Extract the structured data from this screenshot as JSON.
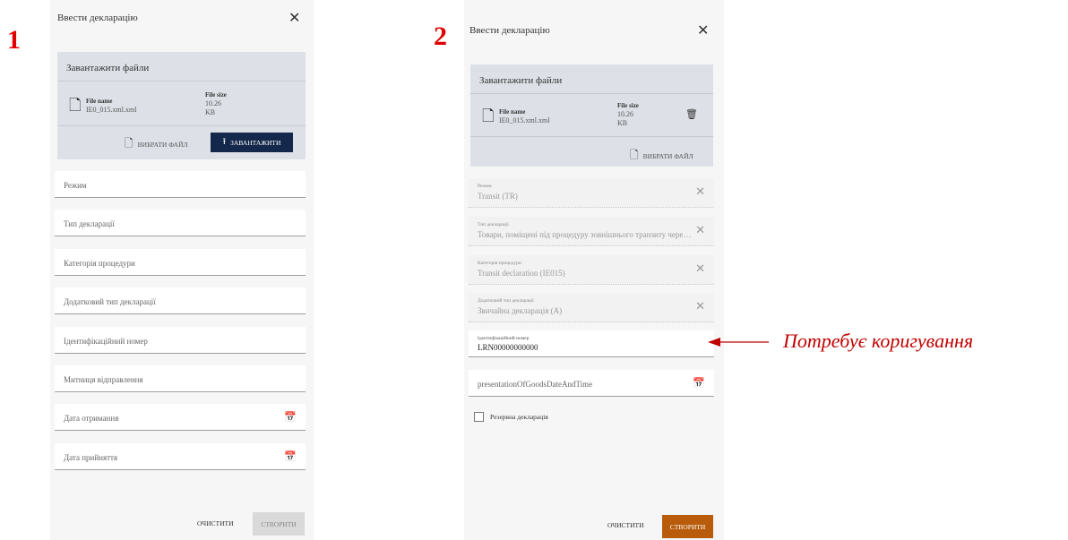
{
  "labels": {
    "step1": "1",
    "step2": "2",
    "annotation": "Потребує коригування"
  },
  "colors": {
    "accent_navy": "#13284a",
    "create_active": "#b85c0b",
    "create_disabled": "#d9d9d9",
    "annotation": "#c00000",
    "step_number": "#e00000"
  },
  "panel1": {
    "title": "Ввести декларацію",
    "upload": {
      "header": "Завантажити файли",
      "file_name_label": "File name",
      "file_name": "IE0_015.xml.xml",
      "file_size_label": "File size",
      "file_size": "10.26",
      "file_size_unit": "KB",
      "choose_label": "ВИБРАТИ ФАЙЛ",
      "upload_label": "ЗАВАНТАЖИТИ"
    },
    "fields": {
      "mode": "Режим",
      "decl_type": "Тип декларації",
      "proc_category": "Категорія процедури",
      "extra_type": "Додатковий тип декларації",
      "id_number": "Ідентифікаційний номер",
      "customs": "Митниця відправлення",
      "received_date": "Дата отримання",
      "accepted_date": "Дата прийняття"
    },
    "clear_label": "ОЧИСТИТИ",
    "create_label": "СТВОРИТИ"
  },
  "panel2": {
    "title": "Ввести декларацію",
    "upload": {
      "header": "Завантажити файли",
      "file_name_label": "File name",
      "file_name": "IE0_015.xml.xml",
      "file_size_label": "File size",
      "file_size": "10.26",
      "file_size_unit": "KB",
      "choose_label": "ВИБРАТИ ФАЙЛ"
    },
    "fields": {
      "mode": {
        "label": "Режим",
        "value": "Transit (TR)"
      },
      "decl_type": {
        "label": "Тип декларації",
        "value": "Товари, поміщені під процедуру зовнішнього транзиту через те..."
      },
      "proc_category": {
        "label": "Категорія процедури",
        "value": "Transit declaration (IE015)"
      },
      "extra_type": {
        "label": "Додатковий тип декларації",
        "value": "Звичайна декларація (А)"
      },
      "id_number": {
        "label": "Ідентифікаційний номер",
        "value": "LRN00000000000"
      },
      "presentation": "presentationOfGoodsDateAndTime"
    },
    "reserve_label": "Резервна декларація",
    "clear_label": "ОЧИСТИТИ",
    "create_label": "СТВОРИТИ"
  }
}
